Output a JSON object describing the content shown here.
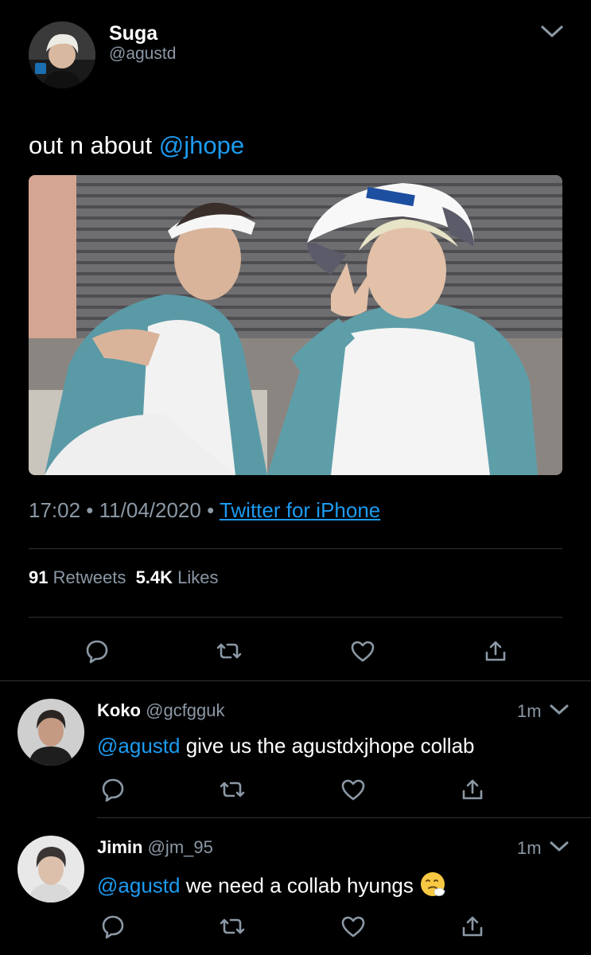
{
  "tweet": {
    "author_name": "Suga",
    "author_handle": "@agustd",
    "text": "out n about ",
    "mention": "@jhope",
    "time": "17:02",
    "sep1": " • ",
    "date": "11/04/2020",
    "sep2": " • ",
    "source": "Twitter for iPhone",
    "retweet_count": "91",
    "retweet_label": "Retweets",
    "like_count": "5.4K",
    "like_label": "Likes"
  },
  "replies": [
    {
      "name": "Koko",
      "handle": "@gcfgguk",
      "time": "1m",
      "mention": "@agustd",
      "text": " give us the agustdxjhope collab"
    },
    {
      "name": "Jimin",
      "handle": "@jm_95",
      "time": "1m",
      "mention": "@agustd",
      "text": " we need a collab hyungs "
    }
  ],
  "colors": {
    "background": "#000000",
    "link": "#1d9bf0",
    "muted": "#8b98a5",
    "divider": "#2f3336"
  },
  "icons": [
    "reply-icon",
    "retweet-icon",
    "like-icon",
    "share-icon",
    "chevron-down-icon",
    "sneezing-face-emoji"
  ]
}
